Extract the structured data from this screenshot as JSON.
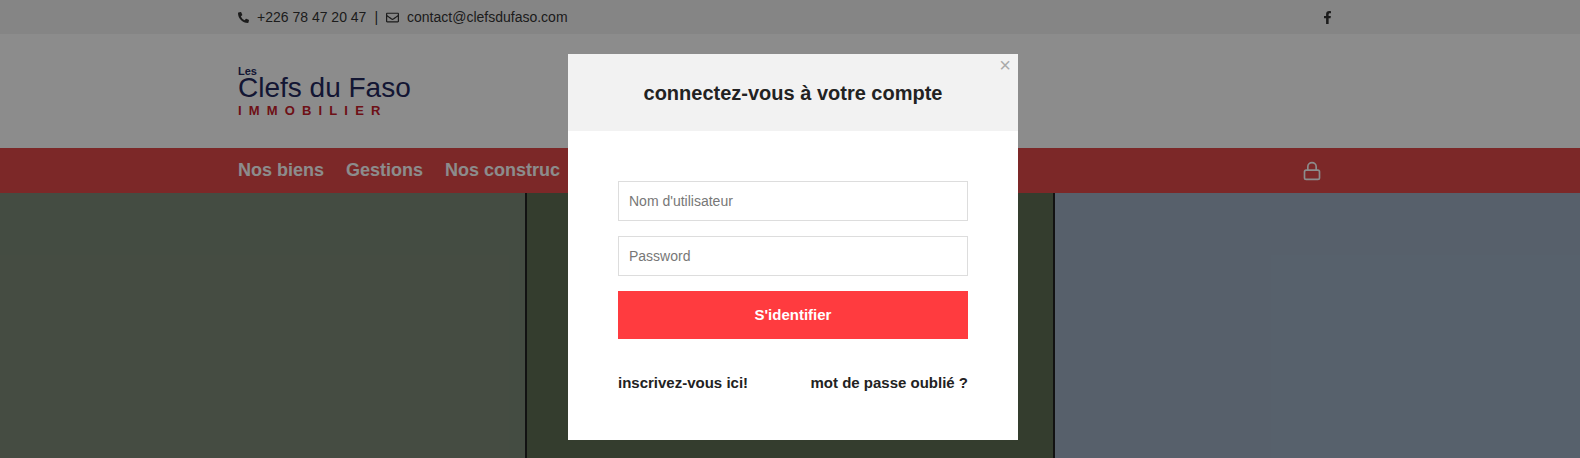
{
  "topbar": {
    "phone": "+226 78 47 20 47",
    "separator": "|",
    "email": "contact@clefsdufaso.com"
  },
  "logo": {
    "small": "Les",
    "main": "Clefs du Faso",
    "sub": "IMMOBILIER"
  },
  "nav": {
    "items": [
      {
        "label": "Nos biens"
      },
      {
        "label": "Gestions"
      },
      {
        "label": "Nos construc"
      }
    ]
  },
  "photos": [
    {
      "color": "#7d8a78"
    },
    {
      "color": "#5f6f55"
    },
    {
      "color": "#9fb0c4"
    }
  ],
  "modal": {
    "title": "connectez-vous à votre compte",
    "close": "×",
    "fields": [
      {
        "placeholder": "Nom d'utilisateur",
        "type": "text"
      },
      {
        "placeholder": "Password",
        "type": "password"
      }
    ],
    "button": "S'identifier",
    "register_link": "inscrivez-vous ici!",
    "forgot_link": "mot de passe oublié ?"
  }
}
